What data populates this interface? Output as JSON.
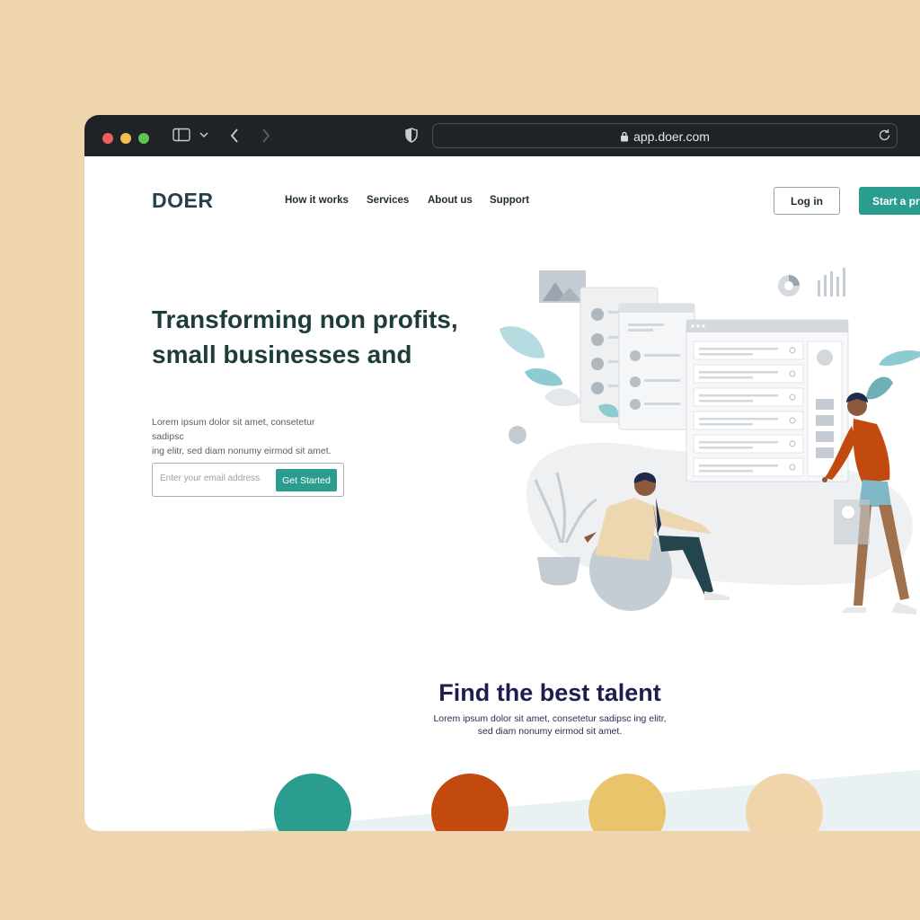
{
  "browser": {
    "url": "app.doer.com"
  },
  "header": {
    "logo": "DOER",
    "nav": [
      "How it works",
      "Services",
      "About us",
      "Support"
    ],
    "login_label": "Log in",
    "start_label": "Start a proj"
  },
  "hero": {
    "title_line1": "Transforming non profits,",
    "title_line2": "small businesses and",
    "desc_line1": "Lorem ipsum dolor sit amet, consetetur sadipsc",
    "desc_line2": "ing elitr, sed diam nonumy eirmod sit amet.",
    "email_placeholder": "Enter your email address",
    "cta_label": "Get Started"
  },
  "talent": {
    "title": "Find the best talent",
    "desc_line1": "Lorem ipsum dolor sit amet, consetetur sadipsc ing elitr,",
    "desc_line2": "sed diam nonumy eirmod sit amet."
  },
  "colors": {
    "brand_teal": "#2A9D8F",
    "circle_1": "#2A9D8F",
    "circle_2": "#C24A0E",
    "circle_3": "#E9C46A",
    "circle_4": "#F0D5AB",
    "background": "#EFD5AD"
  }
}
